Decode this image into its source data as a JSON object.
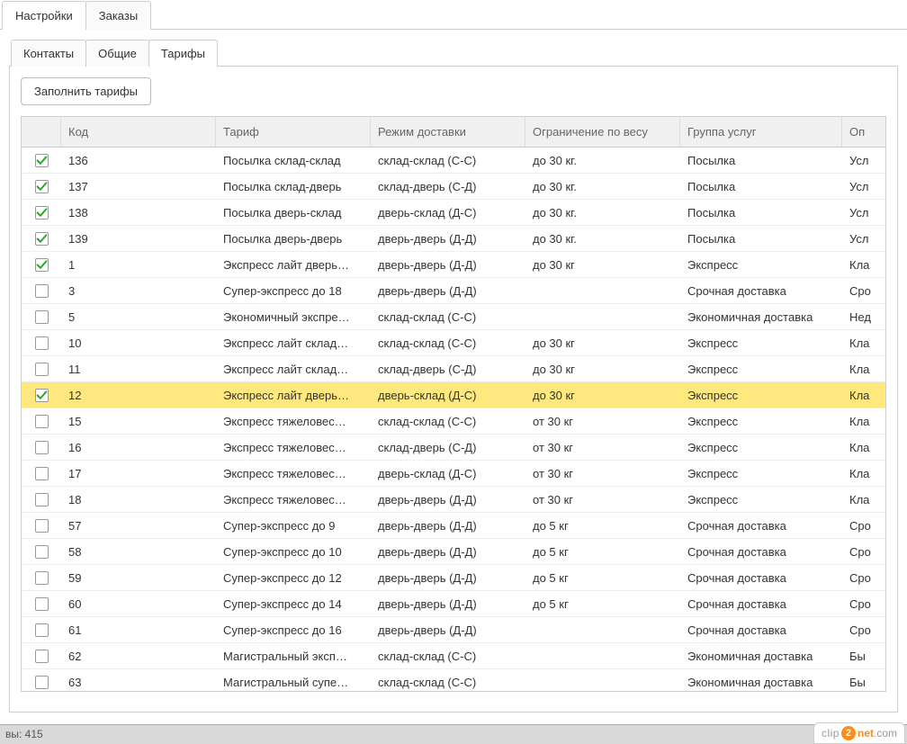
{
  "outer_tabs": [
    "Настройки",
    "Заказы"
  ],
  "outer_active": 0,
  "inner_tabs": [
    "Контакты",
    "Общие",
    "Тарифы"
  ],
  "inner_active": 2,
  "fill_button": "Заполнить тарифы",
  "columns": {
    "check": "",
    "code": "Код",
    "tarif": "Тариф",
    "mode": "Режим доставки",
    "weight": "Ограничение по весу",
    "group": "Группа услуг",
    "desc": "Оп"
  },
  "rows": [
    {
      "checked": true,
      "selected": false,
      "code": "136",
      "tarif": "Посылка склад-склад",
      "mode": "склад-склад (С-С)",
      "weight": "до 30 кг.",
      "group": "Посылка",
      "desc": "Усл"
    },
    {
      "checked": true,
      "selected": false,
      "code": "137",
      "tarif": "Посылка склад-дверь",
      "mode": "склад-дверь (С-Д)",
      "weight": "до 30 кг.",
      "group": "Посылка",
      "desc": "Усл"
    },
    {
      "checked": true,
      "selected": false,
      "code": "138",
      "tarif": "Посылка дверь-склад",
      "mode": "дверь-склад (Д-С)",
      "weight": "до 30 кг.",
      "group": "Посылка",
      "desc": "Усл"
    },
    {
      "checked": true,
      "selected": false,
      "code": "139",
      "tarif": "Посылка дверь-дверь",
      "mode": "дверь-дверь (Д-Д)",
      "weight": "до 30 кг.",
      "group": "Посылка",
      "desc": "Усл"
    },
    {
      "checked": true,
      "selected": false,
      "code": "1",
      "tarif": "Экспресс лайт дверь…",
      "mode": "дверь-дверь (Д-Д)",
      "weight": "до 30 кг",
      "group": "Экспресс",
      "desc": "Кла"
    },
    {
      "checked": false,
      "selected": false,
      "code": "3",
      "tarif": "Супер-экспресс до 18",
      "mode": "дверь-дверь (Д-Д)",
      "weight": "",
      "group": "Срочная доставка",
      "desc": "Сро"
    },
    {
      "checked": false,
      "selected": false,
      "code": "5",
      "tarif": "Экономичный экспре…",
      "mode": "склад-склад (С-С)",
      "weight": "",
      "group": "Экономичная доставка",
      "desc": "Нед"
    },
    {
      "checked": false,
      "selected": false,
      "code": "10",
      "tarif": "Экспресс лайт склад…",
      "mode": "склад-склад (С-С)",
      "weight": "до 30 кг",
      "group": "Экспресс",
      "desc": "Кла"
    },
    {
      "checked": false,
      "selected": false,
      "code": "11",
      "tarif": "Экспресс лайт склад…",
      "mode": "склад-дверь (С-Д)",
      "weight": "до 30 кг",
      "group": "Экспресс",
      "desc": "Кла"
    },
    {
      "checked": true,
      "selected": true,
      "code": "12",
      "tarif": "Экспресс лайт дверь…",
      "mode": "дверь-склад (Д-С)",
      "weight": "до 30 кг",
      "group": "Экспресс",
      "desc": "Кла"
    },
    {
      "checked": false,
      "selected": false,
      "code": "15",
      "tarif": "Экспресс тяжеловес…",
      "mode": "склад-склад (С-С)",
      "weight": "от 30 кг",
      "group": "Экспресс",
      "desc": "Кла"
    },
    {
      "checked": false,
      "selected": false,
      "code": "16",
      "tarif": "Экспресс тяжеловес…",
      "mode": "склад-дверь (С-Д)",
      "weight": "от 30 кг",
      "group": "Экспресс",
      "desc": "Кла"
    },
    {
      "checked": false,
      "selected": false,
      "code": "17",
      "tarif": "Экспресс тяжеловес…",
      "mode": "дверь-склад (Д-С)",
      "weight": "от 30 кг",
      "group": "Экспресс",
      "desc": "Кла"
    },
    {
      "checked": false,
      "selected": false,
      "code": "18",
      "tarif": "Экспресс тяжеловес…",
      "mode": "дверь-дверь (Д-Д)",
      "weight": "от 30 кг",
      "group": "Экспресс",
      "desc": "Кла"
    },
    {
      "checked": false,
      "selected": false,
      "code": "57",
      "tarif": "Супер-экспресс до 9",
      "mode": "дверь-дверь (Д-Д)",
      "weight": "до 5 кг",
      "group": "Срочная доставка",
      "desc": "Сро"
    },
    {
      "checked": false,
      "selected": false,
      "code": "58",
      "tarif": "Супер-экспресс до 10",
      "mode": "дверь-дверь (Д-Д)",
      "weight": "до 5 кг",
      "group": "Срочная доставка",
      "desc": "Сро"
    },
    {
      "checked": false,
      "selected": false,
      "code": "59",
      "tarif": "Супер-экспресс до 12",
      "mode": "дверь-дверь (Д-Д)",
      "weight": "до 5 кг",
      "group": "Срочная доставка",
      "desc": "Сро"
    },
    {
      "checked": false,
      "selected": false,
      "code": "60",
      "tarif": "Супер-экспресс до 14",
      "mode": "дверь-дверь (Д-Д)",
      "weight": "до 5 кг",
      "group": "Срочная доставка",
      "desc": "Сро"
    },
    {
      "checked": false,
      "selected": false,
      "code": "61",
      "tarif": "Супер-экспресс до 16",
      "mode": "дверь-дверь (Д-Д)",
      "weight": "",
      "group": "Срочная доставка",
      "desc": "Сро"
    },
    {
      "checked": false,
      "selected": false,
      "code": "62",
      "tarif": "Магистральный эксп…",
      "mode": "склад-склад (С-С)",
      "weight": "",
      "group": "Экономичная доставка",
      "desc": "Бы"
    },
    {
      "checked": false,
      "selected": false,
      "code": "63",
      "tarif": "Магистральный супе…",
      "mode": "склад-склад (С-С)",
      "weight": "",
      "group": "Экономичная доставка",
      "desc": "Бы"
    }
  ],
  "status_text": "вы: 415",
  "watermark": {
    "clip": "clip",
    "two": "2",
    "net": "net",
    "com": ".com"
  }
}
